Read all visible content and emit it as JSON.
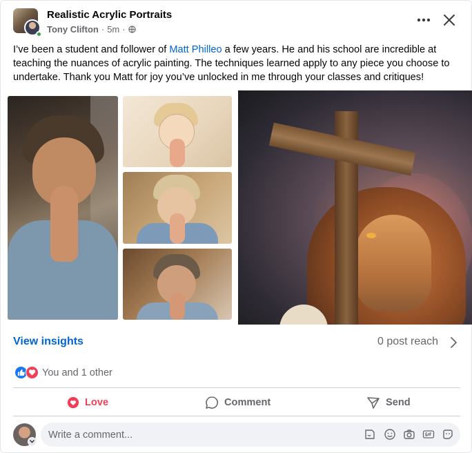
{
  "header": {
    "group_name": "Realistic Acrylic Portraits",
    "author": "Tony Clifton",
    "separator": "·",
    "time": "5m",
    "visibility_icon": "globe-icon",
    "more_icon": "more-dots-icon",
    "close_icon": "close-icon"
  },
  "post": {
    "text_before": "I’ve been a student and follower of ",
    "mention": "Matt Philleo",
    "text_after": " a few years. He and his school are incredible at teaching the nuances of acrylic painting. The techniques learned apply to any piece you choose to undertake. Thank you Matt for joy you’ve unlocked in me through your classes and critiques!"
  },
  "photos": [
    {
      "name": "praying-boy-painting"
    },
    {
      "name": "sketch-stage"
    },
    {
      "name": "underpainting-stage"
    },
    {
      "name": "color-stage"
    },
    {
      "name": "lion-cross-painting"
    }
  ],
  "insights": {
    "link": "View insights",
    "reach": "0 post reach"
  },
  "reactions": {
    "icons": [
      "like-icon",
      "love-icon"
    ],
    "text": "You and 1 other"
  },
  "actions": {
    "love": "Love",
    "comment": "Comment",
    "send": "Send"
  },
  "comment_box": {
    "placeholder": "Write a comment...",
    "icons": [
      "sticker-icon",
      "emoji-icon",
      "camera-icon",
      "gif-icon",
      "avatar-sticker-icon"
    ]
  },
  "colors": {
    "link": "#0064d1",
    "love": "#f33e58",
    "like": "#1877f2",
    "secondary_text": "#65676b"
  }
}
